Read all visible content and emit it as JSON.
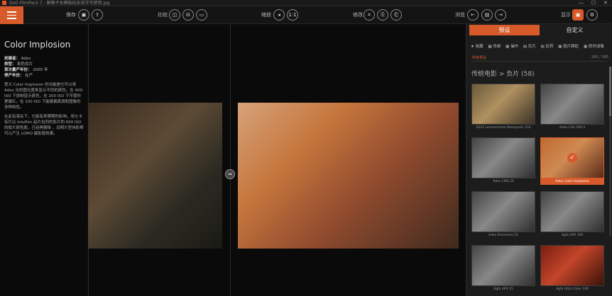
{
  "window": {
    "title": "DxO FilmPack 7 - 图像子女模板玩女孩字写使用.jpg",
    "controls": [
      "—",
      "☐",
      "✕"
    ]
  },
  "toolbar": {
    "save_label": "保存",
    "compare_label": "比较",
    "zoom_label": "缩放",
    "zoom_value": "1:1",
    "edit_label": "修改",
    "browse_label": "浏览",
    "display_label": "显示"
  },
  "info": {
    "preset_name": "Color Implosion",
    "creator_label": "创建者：",
    "creator": "Adox",
    "type_label": "类型：",
    "type": "彩色负片",
    "first_year_label": "首次量产年份：",
    "first_year": "2005 年",
    "last_year_label": "停产年份：",
    "last_year": "在产",
    "desc1": "意义 Color Implosion 的功能是它可以将 Adox 光的图光度来显示不同的颜色。在 400 ISO 下放制显示颜色，在 200 ISO 下可使你更偏红，在 100 ISO 下能偏偏黄调和图像的多种特性。",
    "desc2": "在此有强关下，它能有来哪期的影响，用七卡有片比 Intoflim 起片包同的影片的 600 ISO 的胶片颜色胶，已经再删除 ，旧照片型伟影帮可以产生 LOMO 摄影般效果。"
  },
  "side": {
    "tab_presets": "预设",
    "tab_custom": "自定义",
    "filters": [
      "★ 收藏",
      "▦ 传统",
      "▦ 操作",
      "▤ 负片",
      "▤ 反转",
      "▦ 胶片颗粒",
      "▦ 即时成像"
    ],
    "sub_label": "所有预设",
    "sub_count": "265 / 265",
    "category": "传统电影 > 负片 (58)",
    "thumbs": [
      {
        "label": "2021 Lomochrome Metropolis 110"
      },
      {
        "label": "Adox CHS 100 II"
      },
      {
        "label": "Adox CMS 20"
      },
      {
        "label": "Adox Color Implosion"
      },
      {
        "label": "Adox Silvermax 21"
      },
      {
        "label": "Agfa APX 100"
      },
      {
        "label": "Agfa APX 25"
      },
      {
        "label": "Agfa Ultra Color 100"
      }
    ]
  },
  "colors": {
    "accent": "#d75a2b",
    "background": "#0a0a0a",
    "panel": "#1c1c1c"
  }
}
